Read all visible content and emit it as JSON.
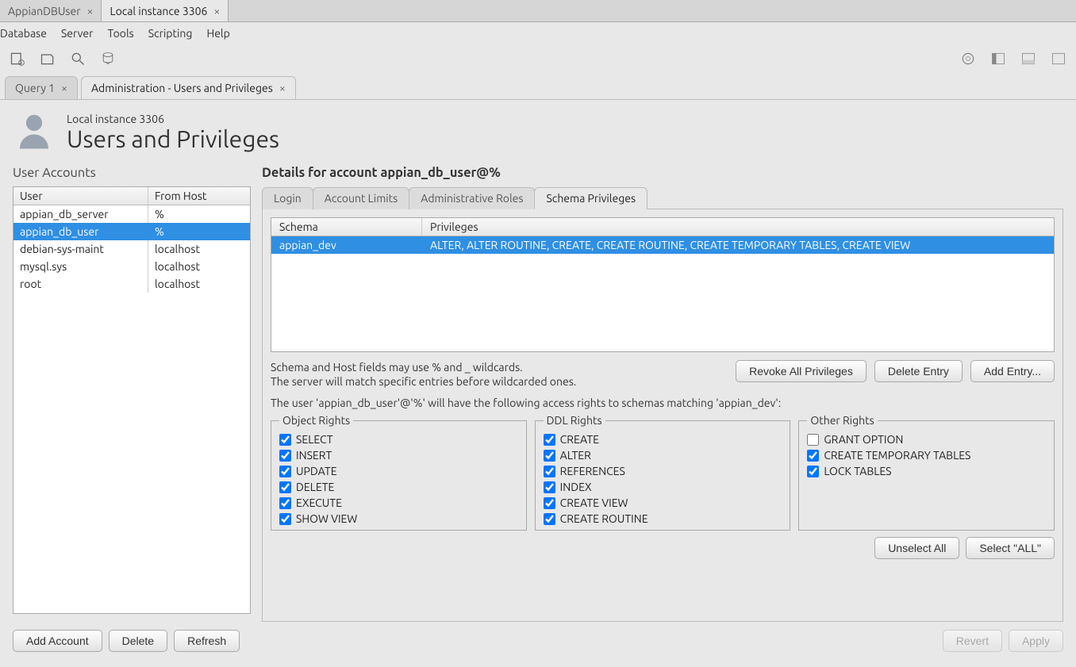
{
  "conn_tabs": [
    {
      "label": "AppianDBUser",
      "active": false
    },
    {
      "label": "Local instance 3306",
      "active": true
    }
  ],
  "menu": [
    "Database",
    "Server",
    "Tools",
    "Scripting",
    "Help"
  ],
  "doc_tabs": [
    {
      "label": "Query 1",
      "active": false
    },
    {
      "label": "Administration - Users and Privileges",
      "active": true
    }
  ],
  "page_subtitle": "Local instance 3306",
  "page_title": "Users and Privileges",
  "left": {
    "heading": "User Accounts",
    "columns": {
      "user": "User",
      "host": "From Host"
    },
    "rows": [
      {
        "user": "appian_db_server",
        "host": "%",
        "selected": false
      },
      {
        "user": "appian_db_user",
        "host": "%",
        "selected": true
      },
      {
        "user": "debian-sys-maint",
        "host": "localhost",
        "selected": false
      },
      {
        "user": "mysql.sys",
        "host": "localhost",
        "selected": false
      },
      {
        "user": "root",
        "host": "localhost",
        "selected": false
      }
    ],
    "buttons": {
      "add": "Add Account",
      "delete": "Delete",
      "refresh": "Refresh"
    }
  },
  "details": {
    "heading": "Details for account appian_db_user@%",
    "tabs": [
      "Login",
      "Account Limits",
      "Administrative Roles",
      "Schema Privileges"
    ],
    "active_tab": 3,
    "schema_columns": {
      "schema": "Schema",
      "privs": "Privileges"
    },
    "schema_rows": [
      {
        "schema": "appian_dev",
        "privs": "ALTER, ALTER ROUTINE, CREATE, CREATE ROUTINE, CREATE TEMPORARY TABLES, CREATE VIEW",
        "selected": true
      }
    ],
    "help1": "Schema and Host fields may use % and _ wildcards.",
    "help2": "The server will match specific entries before wildcarded ones.",
    "schema_buttons": {
      "revoke": "Revoke All Privileges",
      "delete": "Delete Entry",
      "add": "Add Entry..."
    },
    "access_text": "The user 'appian_db_user'@'%' will have the following access rights to schemas matching 'appian_dev':",
    "groups": {
      "object": {
        "legend": "Object Rights",
        "items": [
          {
            "label": "SELECT",
            "checked": true
          },
          {
            "label": "INSERT",
            "checked": true
          },
          {
            "label": "UPDATE",
            "checked": true
          },
          {
            "label": "DELETE",
            "checked": true
          },
          {
            "label": "EXECUTE",
            "checked": true
          },
          {
            "label": "SHOW VIEW",
            "checked": true
          }
        ]
      },
      "ddl": {
        "legend": "DDL Rights",
        "items": [
          {
            "label": "CREATE",
            "checked": true
          },
          {
            "label": "ALTER",
            "checked": true
          },
          {
            "label": "REFERENCES",
            "checked": true
          },
          {
            "label": "INDEX",
            "checked": true
          },
          {
            "label": "CREATE VIEW",
            "checked": true
          },
          {
            "label": "CREATE ROUTINE",
            "checked": true
          }
        ]
      },
      "other": {
        "legend": "Other Rights",
        "items": [
          {
            "label": "GRANT OPTION",
            "checked": false
          },
          {
            "label": "CREATE TEMPORARY TABLES",
            "checked": true
          },
          {
            "label": "LOCK TABLES",
            "checked": true
          }
        ]
      }
    },
    "select_buttons": {
      "unselect": "Unselect All",
      "selectall": "Select \"ALL\""
    },
    "footer_buttons": {
      "revert": "Revert",
      "apply": "Apply"
    }
  }
}
